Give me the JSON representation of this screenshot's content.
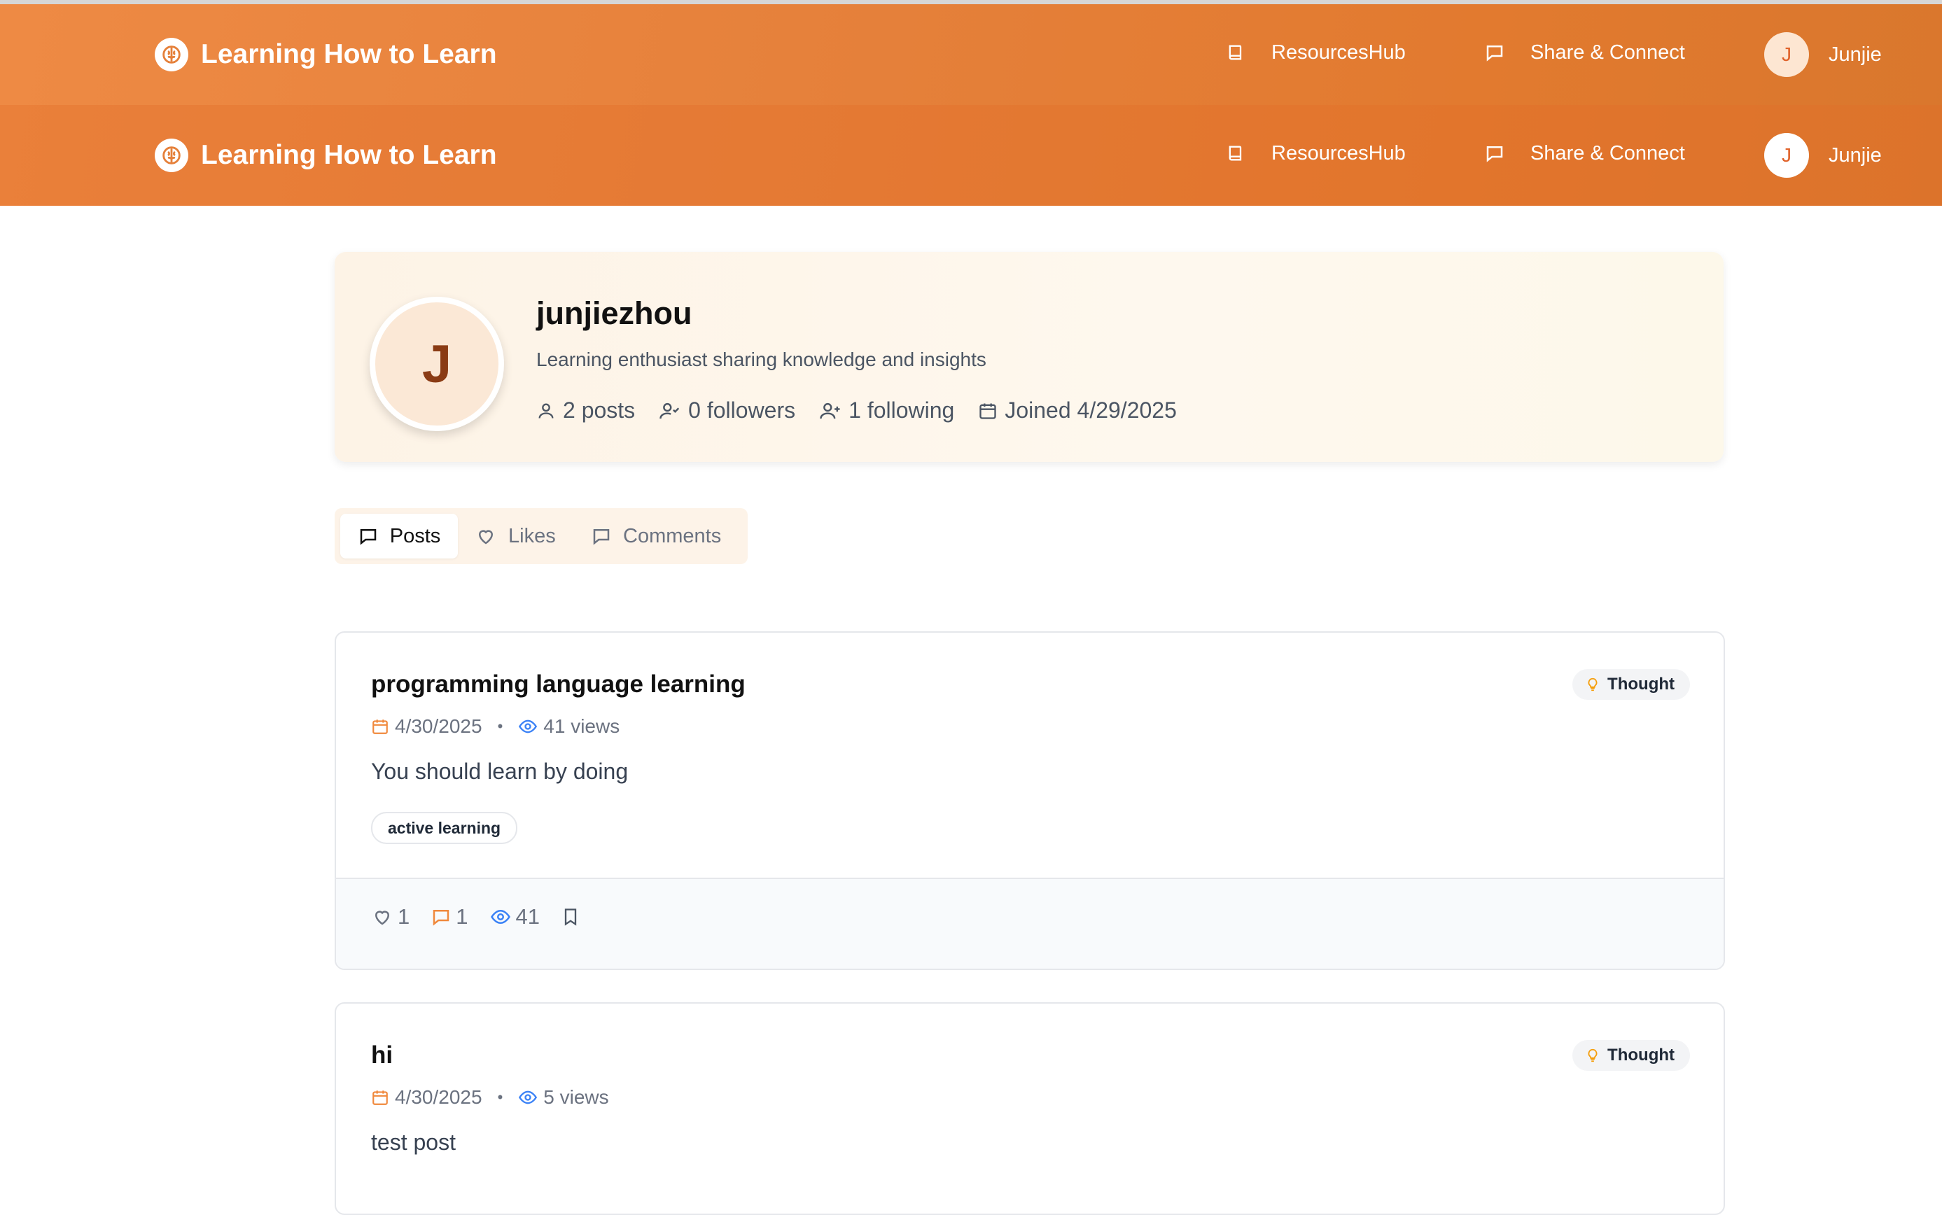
{
  "app": {
    "title": "Learning How to Learn",
    "nav": {
      "resources_label": "ResourcesHub",
      "share_label": "Share & Connect",
      "user_initial": "J",
      "user_name": "Junjie"
    }
  },
  "profile": {
    "avatar_initial": "J",
    "username": "junjiezhou",
    "bio": "Learning enthusiast sharing knowledge and insights",
    "stats": {
      "posts": "2 posts",
      "followers": "0 followers",
      "following": "1 following",
      "joined": "Joined 4/29/2025"
    }
  },
  "tabs": [
    {
      "label": "Posts",
      "active": true
    },
    {
      "label": "Likes",
      "active": false
    },
    {
      "label": "Comments",
      "active": false
    }
  ],
  "posts": [
    {
      "title": "programming language learning",
      "date": "4/30/2025",
      "views_text": "41 views",
      "body": "You should learn by doing",
      "badge": "Thought",
      "tag": "active learning",
      "likes": "1",
      "comments": "1",
      "views": "41"
    },
    {
      "title": "hi",
      "date": "4/30/2025",
      "views_text": "5 views",
      "body": "test post",
      "badge": "Thought"
    }
  ],
  "colors": {
    "brand_orange": "#e5803a",
    "calendar_orange": "#f0893d",
    "view_blue": "#3b82f6",
    "badge_bulb": "#f59e0b"
  }
}
